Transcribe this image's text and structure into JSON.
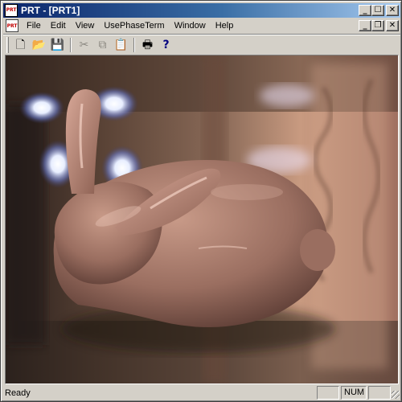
{
  "window": {
    "title": "PRT - [PRT1]",
    "app_icon_text": "PRT"
  },
  "menu": {
    "items": [
      "File",
      "Edit",
      "View",
      "UsePhaseTerm",
      "Window",
      "Help"
    ]
  },
  "toolbar": {
    "buttons": [
      {
        "name": "new-icon",
        "glyph": "🗋",
        "enabled": true
      },
      {
        "name": "open-icon",
        "glyph": "📂",
        "enabled": true
      },
      {
        "name": "save-icon",
        "glyph": "💾",
        "enabled": true
      },
      {
        "name": "cut-icon",
        "glyph": "✂",
        "enabled": false
      },
      {
        "name": "copy-icon",
        "glyph": "⧉",
        "enabled": false
      },
      {
        "name": "paste-icon",
        "glyph": "📋",
        "enabled": false
      },
      {
        "name": "print-icon",
        "glyph": "🖶",
        "enabled": true
      },
      {
        "name": "help-icon",
        "glyph": "?",
        "enabled": true
      }
    ]
  },
  "viewport": {
    "content": "rendered-bunny-scene",
    "accent": "#c08a78"
  },
  "status": {
    "text": "Ready",
    "panes": [
      "",
      "NUM",
      ""
    ]
  }
}
